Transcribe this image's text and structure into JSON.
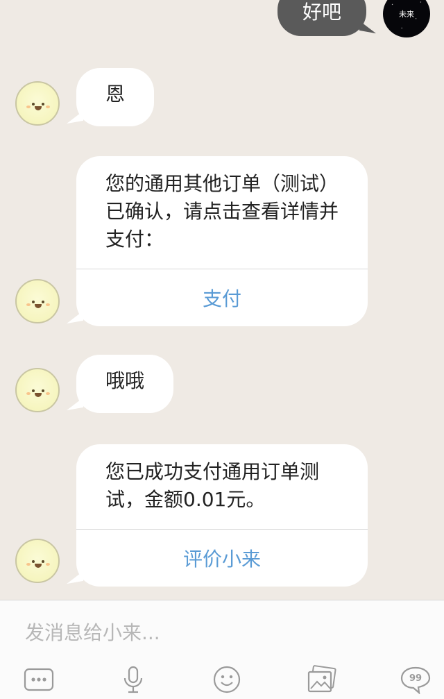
{
  "outgoing": {
    "text": "好吧",
    "avatar_label": "未来"
  },
  "messages": [
    {
      "type": "text",
      "text": "恩"
    },
    {
      "type": "card",
      "text": "您的通用其他订单（测试）已确认，请点击查看详情并支付：",
      "action": "支付"
    },
    {
      "type": "text",
      "text": "哦哦"
    },
    {
      "type": "card",
      "text": "您已成功支付通用订单测试，金额0.01元。",
      "action": "评价小来"
    }
  ],
  "input": {
    "placeholder": "发消息给小来..."
  },
  "toolbar": {
    "icons": [
      "more-icon",
      "microphone-icon",
      "emoji-icon",
      "image-icon",
      "quote-bubble-icon"
    ]
  }
}
